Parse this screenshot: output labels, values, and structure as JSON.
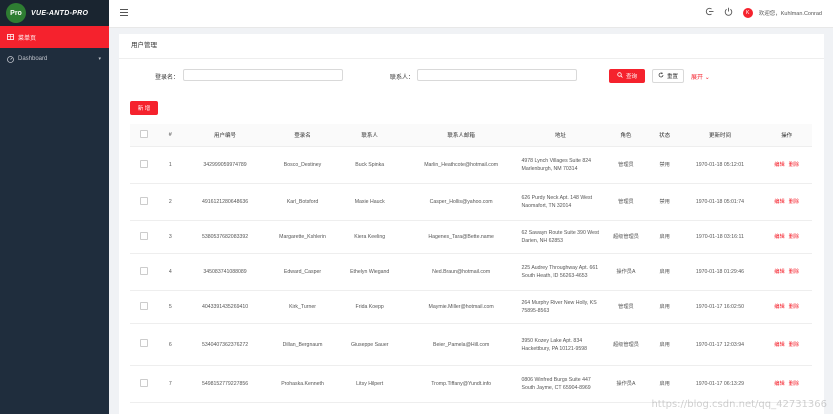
{
  "brand": {
    "badge": "Pro",
    "name": "VUE-ANTD-PRO"
  },
  "sidebar": {
    "items": [
      {
        "label": "菜单页",
        "icon": "table-icon",
        "active": true
      },
      {
        "label": "Dashboard",
        "icon": "dashboard-icon",
        "active": false
      }
    ]
  },
  "header": {
    "avatar_letter": "K",
    "welcome": "欢迎您，Kuhlman.Conrad"
  },
  "page": {
    "title": "用户管理"
  },
  "search": {
    "login_label": "登录名：",
    "contact_label": "联系人：",
    "search_button": "查询",
    "reset_button": "重置",
    "expand": "展开"
  },
  "toolbar": {
    "add_button": "新 增"
  },
  "table": {
    "headers": [
      "",
      "#",
      "用户编号",
      "登录名",
      "联系人",
      "联系人邮箱",
      "地址",
      "角色",
      "状态",
      "更新时间",
      "操作"
    ],
    "edit_label": "编辑",
    "delete_label": "删除",
    "rows": [
      {
        "no": "1",
        "id": "342999059974789",
        "login": "Bosco_Destiney",
        "contact": "Buck Spinka",
        "email": "Marlin_Heathcote@hotmail.com",
        "address": "4978 Lynch Villages Suite 824 Marlenburgh, NM 70314",
        "role": "管理员",
        "status": "禁用",
        "updated": "1970-01-18 05:12:01"
      },
      {
        "no": "2",
        "id": "4916121280648636",
        "login": "Karl_Botsford",
        "contact": "Maxie Hauck",
        "email": "Casper_Hollis@yahoo.com",
        "address": "626 Purdy Neck Apt. 148 West Naomafort, TN 32014",
        "role": "管理员",
        "status": "禁用",
        "updated": "1970-01-18 05:01:74"
      },
      {
        "no": "3",
        "id": "5380537682083392",
        "login": "Margarette_Kshlerin",
        "contact": "Kiera Keeling",
        "email": "Hagenes_Tara@Bette.name",
        "address": "62 Sawayn Route Suite 390 West Darien, NH 62853",
        "role": "超级管理员",
        "status": "启用",
        "updated": "1970-01-18 03:16:11"
      },
      {
        "no": "4",
        "id": "345083741088089",
        "login": "Edward_Casper",
        "contact": "Ethelyn Wiegand",
        "email": "Ned.Braun@hotmail.com",
        "address": "225 Audrey Throughway Apt. 661 South Heath, ID 56263-4653",
        "role": "操作员A",
        "status": "启用",
        "updated": "1970-01-18 01:29:46"
      },
      {
        "no": "5",
        "id": "4043391435269410",
        "login": "Kirk_Turner",
        "contact": "Frida Koepp",
        "email": "Maymie.Miller@hotmail.com",
        "address": "264 Murphy River New Holly, KS 75895-8563",
        "role": "管理员",
        "status": "启用",
        "updated": "1970-01-17 16:02:50"
      },
      {
        "no": "6",
        "id": "5340407362376272",
        "login": "Dillan_Bergnaum",
        "contact": "Giuseppe Sauer",
        "email": "Beier_Pamela@Hill.com",
        "address": "3950 Kozey Lake Apt. 834 Hackettbury, PA 10121-9598",
        "role": "超级管理员",
        "status": "启用",
        "updated": "1970-01-17 12:03:94"
      },
      {
        "no": "7",
        "id": "5498152779227856",
        "login": "Prohaska.Kenneth",
        "contact": "Litsy Hilpert",
        "email": "Tromp.Tiffany@Yundt.info",
        "address": "0806 Winfred Burgs Suite 447 South Jayme, CT 65904-8969",
        "role": "操作员A",
        "status": "启用",
        "updated": "1970-01-17 06:13:29"
      }
    ]
  },
  "watermark": "https://blog.csdn.net/qq_42731366",
  "colors": {
    "accent": "#f5222d",
    "sidebar": "#1f2d3d"
  }
}
